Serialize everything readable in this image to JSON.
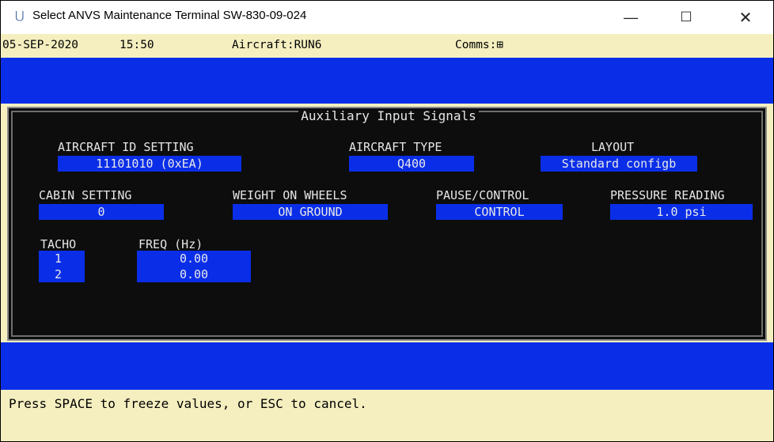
{
  "window": {
    "icon": "app-icon",
    "title": "Select ANVS Maintenance Terminal SW-830-09-024",
    "minimize_glyph": "—",
    "maximize_glyph": "☐",
    "close_glyph": "✕"
  },
  "status": {
    "date": "05-SEP-2020",
    "time": "15:50",
    "aircraft": "Aircraft:RUN6",
    "comms": "Comms:⊞"
  },
  "panel": {
    "title": "Auxiliary Input Signals",
    "aircraft_id": {
      "label": "AIRCRAFT ID SETTING",
      "value": "11101010 (0xEA)"
    },
    "aircraft_type": {
      "label": "AIRCRAFT TYPE",
      "value": "Q400"
    },
    "layout": {
      "label": "LAYOUT",
      "value": "Standard configb"
    },
    "cabin": {
      "label": "CABIN SETTING",
      "value": "0"
    },
    "wow": {
      "label": "WEIGHT ON WHEELS",
      "value": "ON GROUND"
    },
    "pause": {
      "label": "PAUSE/CONTROL",
      "value": "CONTROL"
    },
    "pressure": {
      "label": "PRESSURE READING",
      "value": "1.0 psi"
    },
    "tacho": {
      "tacho_label": "TACHO",
      "freq_label": "FREQ (Hz)",
      "rows": [
        {
          "id": "1",
          "freq": "0.00"
        },
        {
          "id": "2",
          "freq": "0.00"
        }
      ]
    }
  },
  "prompt": "Press SPACE to freeze values, or ESC to cancel.",
  "colors": {
    "blue": "#0a2ee8",
    "panel_bg": "#0d0d0d",
    "status_bg": "#f5efc0"
  }
}
